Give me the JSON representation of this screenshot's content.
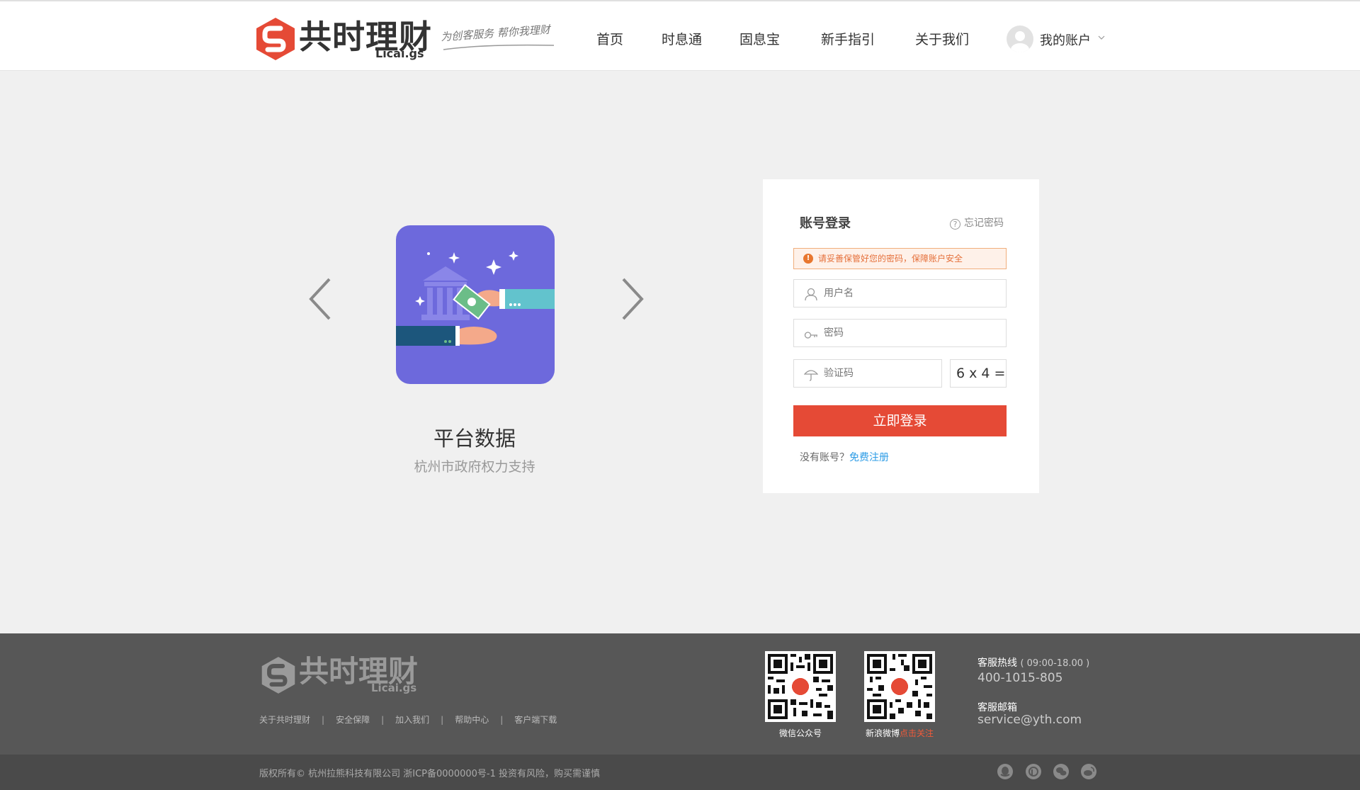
{
  "header": {
    "logo_cn": "共时理财",
    "logo_en": "Licai.gs",
    "slogan": "为创客服务 帮你我理财",
    "nav": [
      "首页",
      "时息通",
      "固息宝",
      "新手指引",
      "关于我们"
    ],
    "account_label": "我的账户"
  },
  "carousel": {
    "title": "平台数据",
    "subtitle": "杭州市政府权力支持"
  },
  "login": {
    "title": "账号登录",
    "forgot": "忘记密码",
    "notice": "请妥善保管好您的密码，保障账户安全",
    "username_placeholder": "用户名",
    "password_placeholder": "密码",
    "captcha_placeholder": "验证码",
    "captcha_text": "6 x 4 =",
    "submit": "立即登录",
    "no_account": "没有账号？",
    "register": "免费注册"
  },
  "footer": {
    "logo_cn": "共时理财",
    "logo_en": "Licai.gs",
    "links": [
      "关于共时理财",
      "安全保障",
      "加入我们",
      "帮助中心",
      "客户端下载"
    ],
    "qr_wechat_label": "微信公众号",
    "qr_weibo_label": "新浪微博",
    "qr_weibo_follow": "点击关注",
    "hotline_label": "客服热线",
    "hotline_hours": "( 09:00-18.00 )",
    "hotline_number": "400-1015-805",
    "email_label": "客服邮箱",
    "email": "service@yth.com",
    "copyright": "版权所有© 杭州拉熊科技有限公司  浙ICP备0000000号-1  投资有风险，购买需谨慎"
  },
  "colors": {
    "brand_red": "#e54a36",
    "link_blue": "#2d9ce6",
    "slide_bg": "#6d69dc",
    "footer_bg": "#575757"
  },
  "icons": [
    "logo-mark",
    "user-icon",
    "key-icon",
    "umbrella-icon",
    "question-icon",
    "warning-icon",
    "qq-icon",
    "alipay-icon",
    "wechat-icon",
    "weibo-icon"
  ]
}
